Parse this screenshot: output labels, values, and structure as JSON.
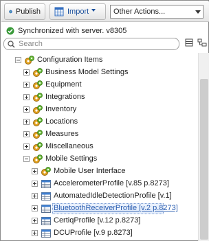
{
  "toolbar": {
    "publish_label": "Publish",
    "import_label": "Import",
    "actions_select_value": "Other Actions..."
  },
  "status": {
    "text": "Synchronized with server. v8305",
    "color": "#3a9a3a"
  },
  "search": {
    "placeholder": "Search"
  },
  "tree": {
    "root": {
      "label": "Configuration Items"
    },
    "items": [
      {
        "label": "Business Model Settings"
      },
      {
        "label": "Equipment"
      },
      {
        "label": "Integrations"
      },
      {
        "label": "Inventory"
      },
      {
        "label": "Locations"
      },
      {
        "label": "Measures"
      },
      {
        "label": "Miscellaneous"
      },
      {
        "label": "Mobile Settings"
      }
    ],
    "mobile_children": [
      {
        "label": "Mobile User Interface"
      },
      {
        "label": "AccelerometerProfile [v.85 p.8273]"
      },
      {
        "label": "AutomatedIdleDetectionProfile [v.1]"
      },
      {
        "label": "BluetoothReceiverProfile [v.2 p.8273]"
      },
      {
        "label": "CertiqProfile [v.12 p.8273]"
      },
      {
        "label": "DCUProfile [v.9 p.8273]"
      }
    ]
  }
}
